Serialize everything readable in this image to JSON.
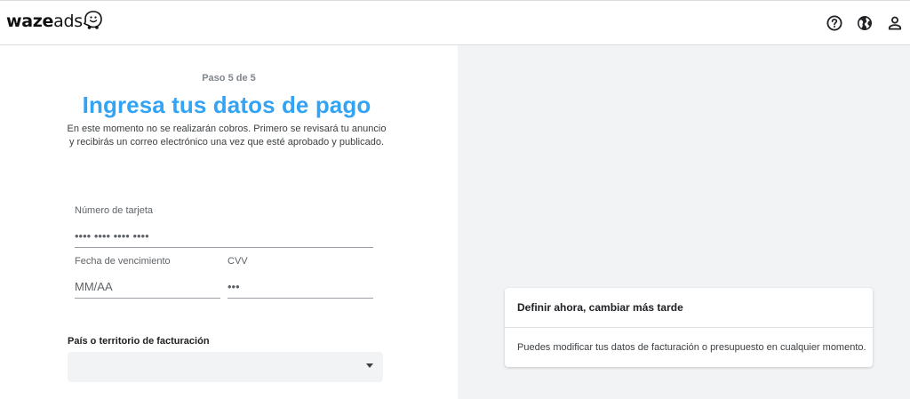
{
  "header": {
    "logo_waze": "waze",
    "logo_ads": "ads",
    "icons": [
      "help-icon",
      "globe-icon",
      "account-icon"
    ]
  },
  "main": {
    "step": "Paso 5 de 5",
    "title": "Ingresa tus datos de pago",
    "subtitle": "En este momento no se realizarán cobros. Primero se revisará tu anuncio y recibirás un correo electrónico una vez que esté aprobado y publicado."
  },
  "form": {
    "card_number": {
      "label": "Número de tarjeta",
      "placeholder": "•••• •••• •••• ••••"
    },
    "expiry": {
      "label": "Fecha de vencimiento",
      "placeholder": "MM/AA"
    },
    "cvv": {
      "label": "CVV",
      "placeholder": "•••"
    },
    "country": {
      "label": "País o territorio de facturación",
      "value": ""
    }
  },
  "info_card": {
    "title": "Definir ahora, cambiar más tarde",
    "body": "Puedes modificar tus datos de facturación o presupuesto en cualquier momento."
  },
  "colors": {
    "title_blue": "#33a3f4",
    "panel_gray": "#f1f3f4"
  }
}
